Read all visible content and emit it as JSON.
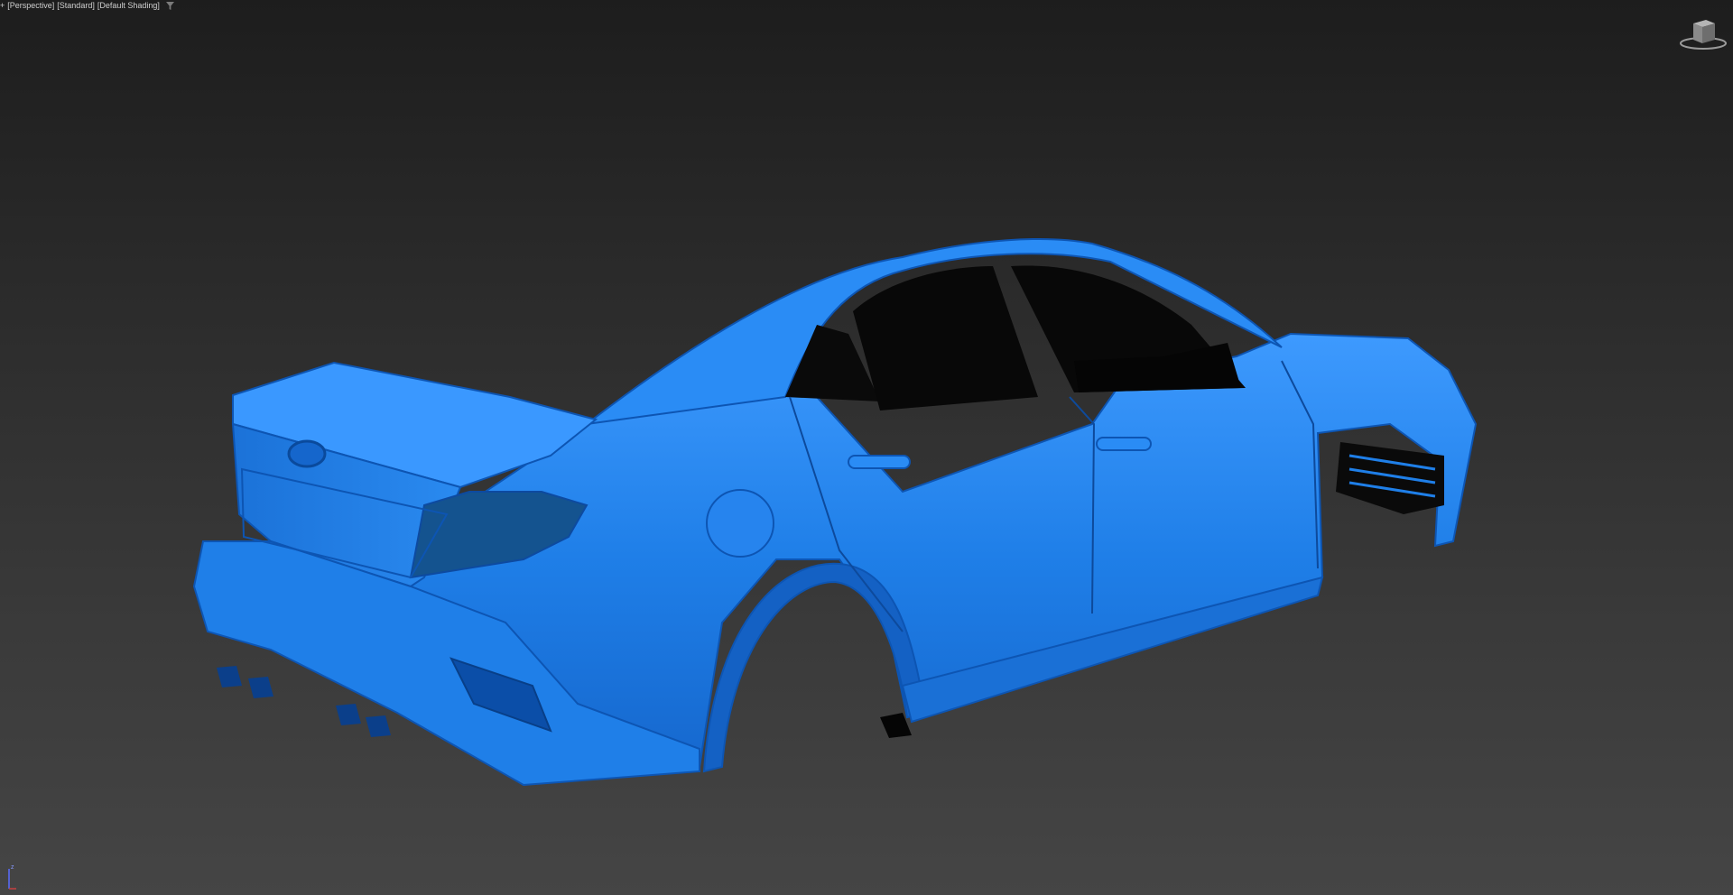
{
  "viewport": {
    "menu_glyph": "+",
    "labels": [
      "[Perspective]",
      "[Standard]",
      "[Default Shading]"
    ]
  },
  "icons": {
    "filter": "filter-icon",
    "viewcube": "viewcube-icon",
    "axis": "axis-tripod-icon"
  },
  "colors": {
    "model": "#1f7fe8",
    "model_shadow": "#0b4ea8",
    "model_highlight": "#5fb0ff",
    "background_top": "#1d1d1d",
    "background_bottom": "#454545"
  },
  "axis": {
    "z_label": "z"
  }
}
